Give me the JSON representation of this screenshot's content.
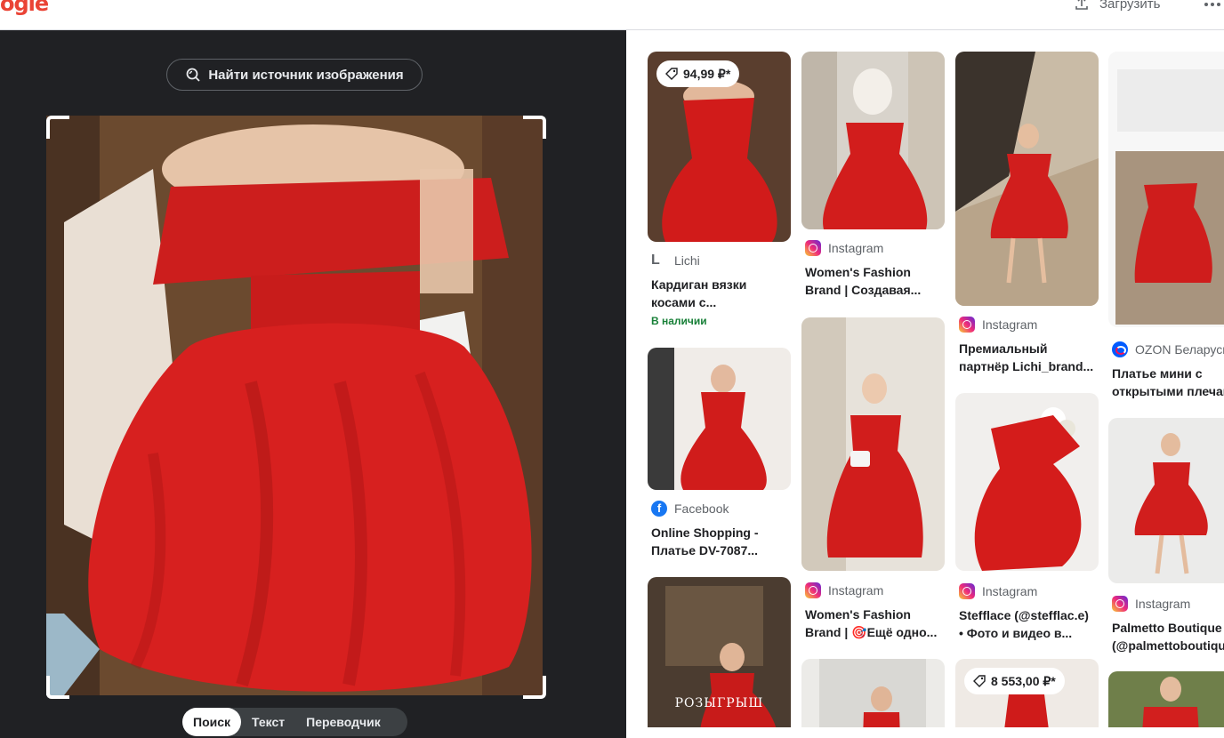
{
  "header": {
    "logo_text": "ogle",
    "upload_label": "Загрузить"
  },
  "lens": {
    "find_source_label": "Найти источник изображения",
    "modes": [
      "Поиск",
      "Текст",
      "Переводчик"
    ],
    "active_mode": "Поиск"
  },
  "results": [
    {
      "price": "94,99 ₽*",
      "source": "Lichi",
      "title_lines": [
        "Кардиган вязки",
        "косами с..."
      ],
      "stock": "В наличии"
    },
    {
      "source": "Instagram",
      "title_lines": [
        "Women's Fashion",
        "Brand | Создавая..."
      ]
    },
    {
      "source": "Instagram",
      "title_lines": [
        "Премиальный",
        "партнёр Lichi_brand..."
      ]
    },
    {
      "source": "OZON Беларусь",
      "title_lines": [
        "Платье мини с",
        "открытыми плечами"
      ]
    },
    {
      "source": "Facebook",
      "title_lines": [
        "Online Shopping -",
        "Платье DV-7087..."
      ]
    },
    {
      "source": "Instagram",
      "title_lines": [
        "Women's Fashion",
        "Brand | 🎯Ещё одно..."
      ]
    },
    {
      "source": "Instagram",
      "title_lines": [
        "Stefflace (@stefflac.e)",
        "• Фото и видео в..."
      ]
    },
    {
      "source": "Instagram",
      "title_lines": [
        "Palmetto Boutique",
        "(@palmettoboutique)"
      ]
    },
    {
      "overlay_text": "РОЗЫГРЫШ"
    },
    {
      "price": "8 553,00 ₽*"
    }
  ],
  "colors": {
    "dark_panel": "#202124",
    "dress_red": "#d7201f",
    "in_stock_green": "#188038"
  }
}
